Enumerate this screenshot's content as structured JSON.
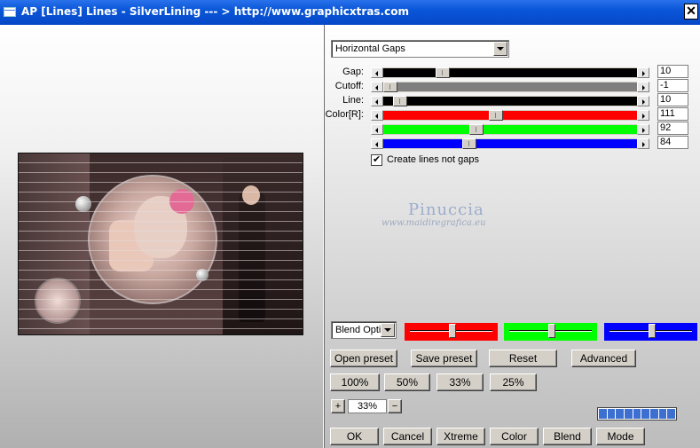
{
  "window": {
    "title": "AP [Lines]  Lines - SilverLining     --- > http://www.graphicxtras.com",
    "close_glyph": "✕"
  },
  "controls": {
    "mode_dropdown": "Horizontal Gaps",
    "sliders": [
      {
        "label": "Gap:",
        "value": "10",
        "fraction": 0.22,
        "track_color": "#000000"
      },
      {
        "label": "Cutoff:",
        "value": "-1",
        "fraction": 0.0,
        "track_color": "#7f7f7f"
      },
      {
        "label": "Line:",
        "value": "10",
        "fraction": 0.04,
        "track_color": "#000000"
      },
      {
        "label": "Color[R]:",
        "value": "111",
        "fraction": 0.44,
        "track_color": "#ff0000"
      },
      {
        "label": "",
        "value": "92",
        "fraction": 0.36,
        "track_color": "#00ff00"
      },
      {
        "label": "",
        "value": "84",
        "fraction": 0.33,
        "track_color": "#0000ff"
      }
    ],
    "create_lines_checkbox": {
      "label": "Create lines not gaps",
      "checked": true
    },
    "watermark": {
      "name": "Pinuccia",
      "url": "www.maidiregrafica.eu"
    },
    "blend_dropdown": "Blend Optio",
    "color_swatch_sliders": [
      {
        "color": "#ff0000",
        "fraction": 0.5
      },
      {
        "color": "#00ff00",
        "fraction": 0.5
      },
      {
        "color": "#0000ff",
        "fraction": 0.5
      }
    ],
    "buttons_row1": {
      "open_preset": "Open preset",
      "save_preset": "Save preset",
      "reset": "Reset",
      "advanced": "Advanced"
    },
    "zoom_buttons": {
      "z100": "100%",
      "z50": "50%",
      "z33": "33%",
      "z25": "25%"
    },
    "zoom": {
      "plus": "+",
      "minus": "−",
      "value": "33%"
    },
    "progress": {
      "segments": 9
    },
    "bottom_buttons": {
      "ok": "OK",
      "cancel": "Cancel",
      "xtreme": "Xtreme",
      "color": "Color",
      "blend": "Blend",
      "mode": "Mode"
    }
  }
}
